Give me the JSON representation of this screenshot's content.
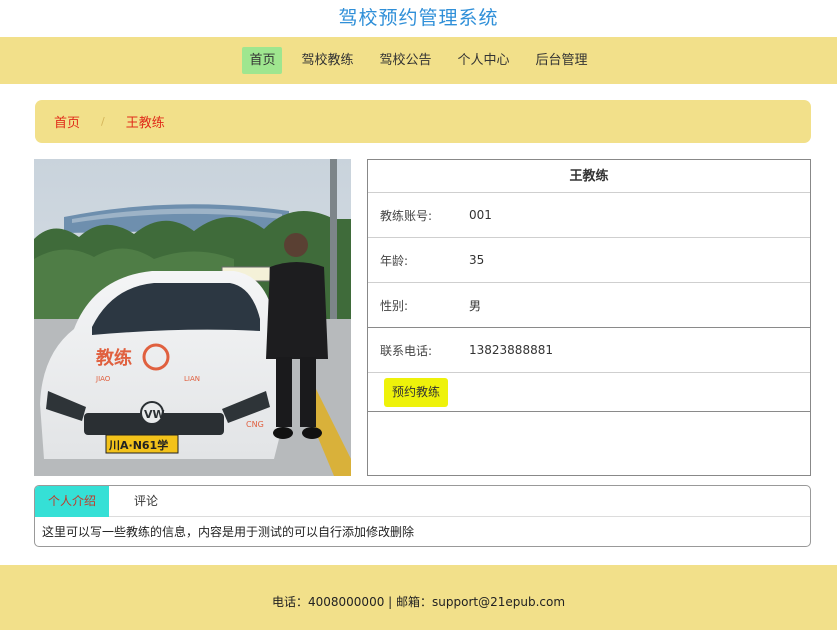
{
  "site": {
    "title": "驾校预约管理系统"
  },
  "nav": {
    "items": [
      {
        "label": "首页",
        "active": true
      },
      {
        "label": "驾校教练",
        "active": false
      },
      {
        "label": "驾校公告",
        "active": false
      },
      {
        "label": "个人中心",
        "active": false
      },
      {
        "label": "后台管理",
        "active": false
      }
    ]
  },
  "breadcrumb": {
    "home": "首页",
    "separator": "/",
    "current": "王教练"
  },
  "coach": {
    "name": "王教练",
    "fields": [
      {
        "label": "教练账号:",
        "value": "001"
      },
      {
        "label": "年龄:",
        "value": "35"
      },
      {
        "label": "性别:",
        "value": "男"
      },
      {
        "label": "联系电话:",
        "value": "13823888881"
      }
    ],
    "book_label": "预约教练",
    "photo": {
      "car_hood_text": "教练",
      "car_hood_sub_left": "JIAO",
      "car_hood_sub_right": "LIAN",
      "plate": "川A·N61学",
      "side_text": "CNG"
    }
  },
  "tabs": {
    "items": [
      {
        "label": "个人介绍",
        "active": true
      },
      {
        "label": "评论",
        "active": false
      }
    ],
    "content": "这里可以写一些教练的信息，内容是用于测试的可以自行添加修改删除"
  },
  "footer": {
    "text": "电话：4008000000 | 邮箱：support@21epub.com"
  },
  "colors": {
    "title": "#2f8fd8",
    "bar": "#f2e08a",
    "nav_active": "#9fe68f",
    "crumb": "#e02c1a",
    "book_button": "#eef20a",
    "tab_active": "#35e0d6"
  }
}
